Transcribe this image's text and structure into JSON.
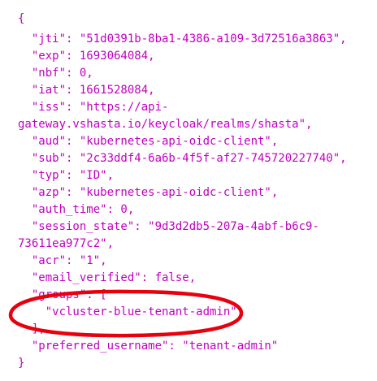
{
  "code": {
    "lines": [
      "{",
      "  \"jti\": \"51d0391b-8ba1-4386-a109-3d72516a3863\",",
      "  \"exp\": 1693064084,",
      "  \"nbf\": 0,",
      "  \"iat\": 1661528084,",
      "  \"iss\": \"https://api-",
      "gateway.vshasta.io/keycloak/realms/shasta\",",
      "  \"aud\": \"kubernetes-api-oidc-client\",",
      "  \"sub\": \"2c33ddf4-6a6b-4f5f-af27-745720227740\",",
      "  \"typ\": \"ID\",",
      "  \"azp\": \"kubernetes-api-oidc-client\",",
      "  \"auth_time\": 0,",
      "  \"session_state\": \"9d3d2db5-207a-4abf-b6c9-",
      "73611ea977c2\",",
      "  \"acr\": \"1\",",
      "  \"email_verified\": false,",
      "  \"groups\": [",
      "    \"vcluster-blue-tenant-admin\"",
      "  ],",
      "  \"preferred_username\": \"tenant-admin\"",
      "}"
    ]
  },
  "colors": {
    "text": "#c000c0",
    "annotation": "#e8000e",
    "background": "#ffffff"
  },
  "annotation": {
    "shape": "ellipse",
    "target": "groups"
  }
}
